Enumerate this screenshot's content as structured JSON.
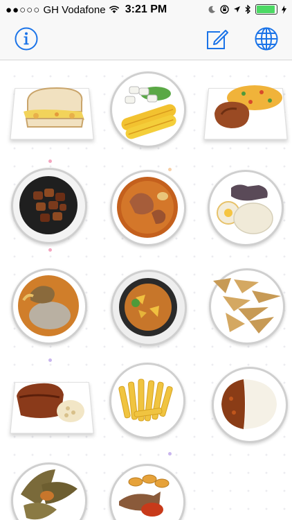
{
  "status_bar": {
    "signal": "●●○○○",
    "carrier": "GH Vodafone",
    "time": "3:21 PM",
    "battery_level": 0.88
  },
  "nav": {
    "info_icon": "info-icon",
    "compose_icon": "compose-icon",
    "globe_icon": "globe-icon",
    "accent": "#1a73e8"
  },
  "foods": [
    {
      "name": "sandwich",
      "style": "tray"
    },
    {
      "name": "roasted corn with coconut",
      "style": "plate"
    },
    {
      "name": "jollof rice with chicken",
      "style": "tray"
    },
    {
      "name": "kelewele",
      "style": "bowl"
    },
    {
      "name": "light soup",
      "style": "plate"
    },
    {
      "name": "banku with tilapia",
      "style": "plate"
    },
    {
      "name": "fufu with soup",
      "style": "plate"
    },
    {
      "name": "palm nut soup",
      "style": "bowl"
    },
    {
      "name": "groundnut brittle",
      "style": "plate"
    },
    {
      "name": "grilled meat with beans",
      "style": "tray"
    },
    {
      "name": "fried plantain chips",
      "style": "plate"
    },
    {
      "name": "rice and stew",
      "style": "plate"
    },
    {
      "name": "kenkey",
      "style": "plate"
    },
    {
      "name": "fried fish with plantain",
      "style": "plate"
    }
  ]
}
